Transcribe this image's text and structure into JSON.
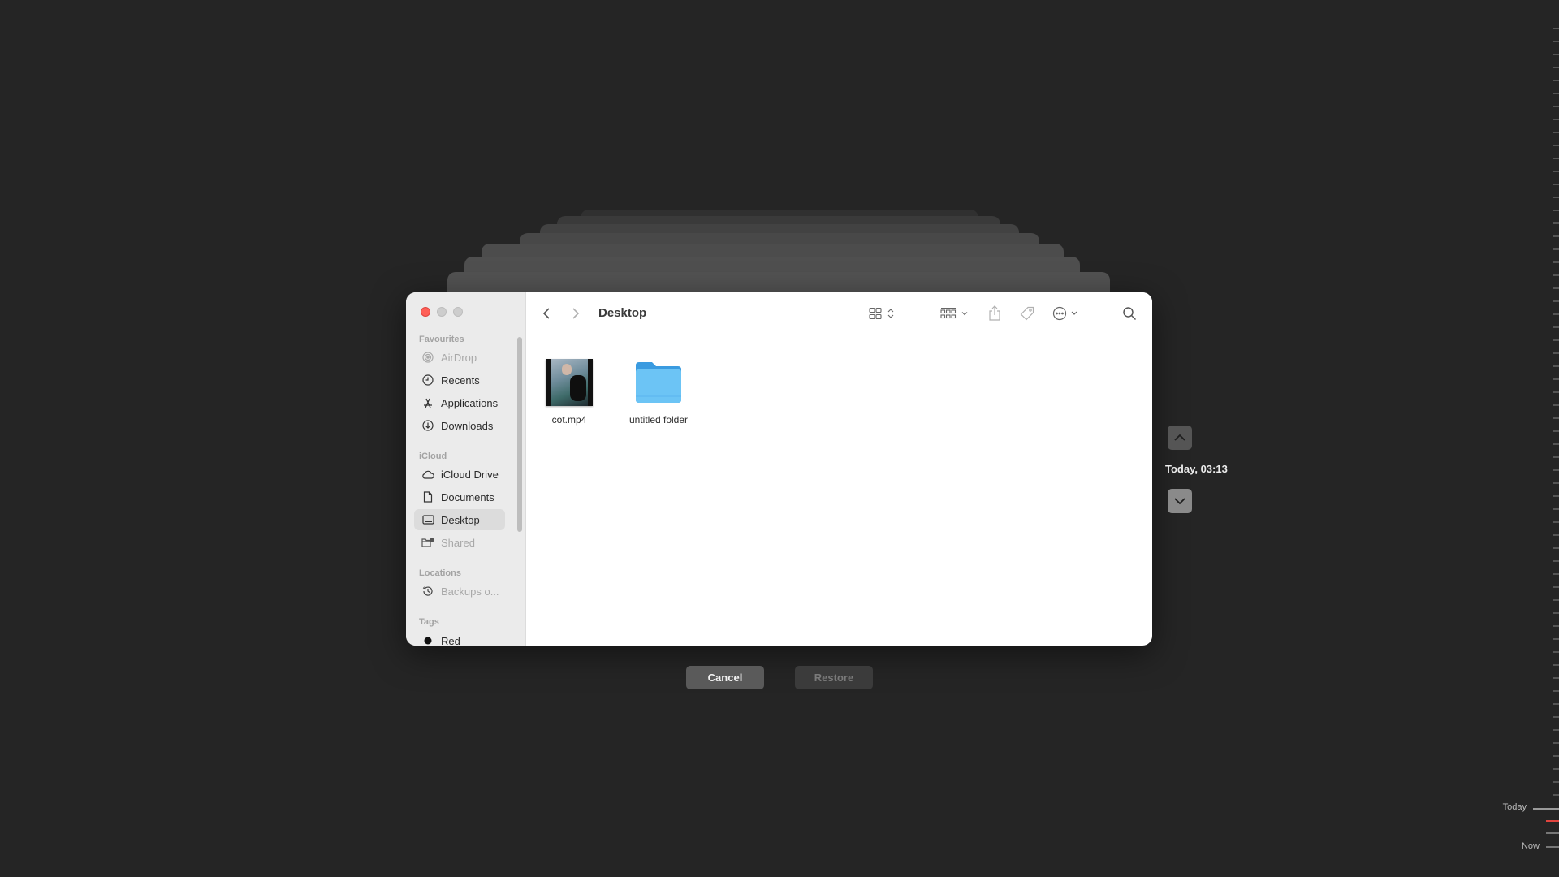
{
  "window": {
    "title": "Desktop",
    "traffic_lights": [
      "close",
      "minimize",
      "zoom"
    ]
  },
  "sidebar": {
    "sections": [
      {
        "label": "Favourites",
        "items": [
          {
            "label": "AirDrop",
            "icon": "airdrop-icon",
            "dimmed": true
          },
          {
            "label": "Recents",
            "icon": "clock-icon"
          },
          {
            "label": "Applications",
            "icon": "applications-icon"
          },
          {
            "label": "Downloads",
            "icon": "download-icon"
          }
        ]
      },
      {
        "label": "iCloud",
        "items": [
          {
            "label": "iCloud Drive",
            "icon": "cloud-icon"
          },
          {
            "label": "Documents",
            "icon": "document-icon"
          },
          {
            "label": "Desktop",
            "icon": "desktop-icon",
            "selected": true
          },
          {
            "label": "Shared",
            "icon": "shared-folder-icon",
            "dimmed": true
          }
        ]
      },
      {
        "label": "Locations",
        "items": [
          {
            "label": "Backups o...",
            "icon": "time-machine-icon",
            "dimmed": true
          }
        ]
      },
      {
        "label": "Tags",
        "items": [
          {
            "label": "Red",
            "icon": "tag-dot-icon"
          }
        ]
      }
    ]
  },
  "toolbar": {
    "back": "back-icon",
    "forward": "forward-icon",
    "view_mode": "icon-view-icon",
    "group": "group-icon",
    "share": "share-icon",
    "tag": "tag-icon",
    "more": "more-icon",
    "search": "search-icon"
  },
  "files": [
    {
      "name": "cot.mp4",
      "type": "video"
    },
    {
      "name": "untitled folder",
      "type": "folder"
    }
  ],
  "buttons": {
    "cancel": "Cancel",
    "restore": "Restore"
  },
  "time_machine": {
    "current_snapshot": "Today, 03:13",
    "timeline_labels": {
      "today": "Today",
      "now": "Now"
    }
  },
  "colors": {
    "close": "#fe5f57",
    "folder": "#5ab4ee",
    "timeline_marker": "#e0443e"
  }
}
